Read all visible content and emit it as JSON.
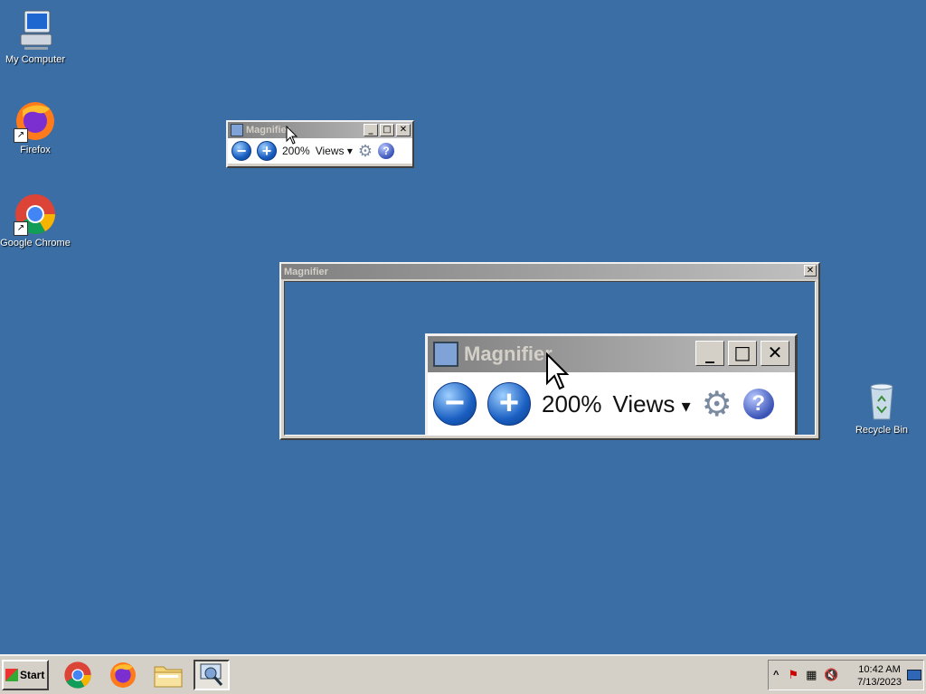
{
  "desktop": {
    "icons": [
      {
        "label": "My Computer"
      },
      {
        "label": "Firefox"
      },
      {
        "label": "Google Chrome"
      },
      {
        "label": "Recycle Bin"
      }
    ]
  },
  "magnifier_toolbar": {
    "title": "Magnifier",
    "zoom": "200%",
    "views_label": "Views",
    "buttons": {
      "minimize": "_",
      "maximize": "□",
      "close": "✕",
      "zoom_out": "−",
      "zoom_in": "+",
      "help": "?"
    }
  },
  "magnifier_lens": {
    "title": "Magnifier",
    "close": "✕",
    "zoomed_title": "Magnifier",
    "zoomed_zoom": "200%",
    "zoomed_views_label": "Views"
  },
  "taskbar": {
    "start_label": "Start",
    "apps": [
      {
        "icon": "chrome-icon"
      },
      {
        "icon": "firefox-icon"
      },
      {
        "icon": "file-explorer-icon"
      },
      {
        "icon": "magnifier-icon",
        "active": true
      }
    ],
    "tray": {
      "time": "10:42 AM",
      "date": "7/13/2023",
      "expand": "^"
    }
  },
  "colors": {
    "desktop_bg": "#3a6ea5",
    "chrome_face": "#d4d0c8"
  }
}
